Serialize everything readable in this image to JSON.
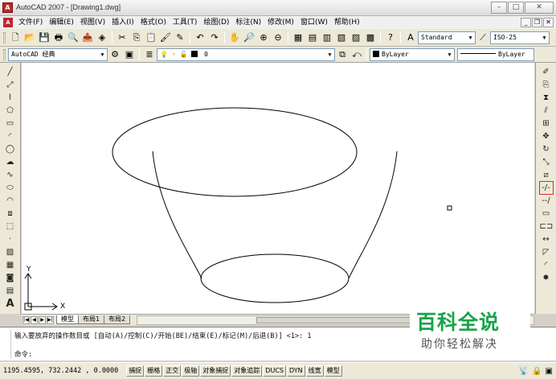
{
  "window": {
    "title": "AutoCAD 2007 - [Drawing1.dwg]",
    "app_icon": "autocad-logo",
    "min": "–",
    "max": "□",
    "close": "✕"
  },
  "menu": {
    "items": [
      "文件(F)",
      "编辑(E)",
      "视图(V)",
      "插入(I)",
      "格式(O)",
      "工具(T)",
      "绘图(D)",
      "标注(N)",
      "修改(M)",
      "窗口(W)",
      "帮助(H)"
    ],
    "doc_min": "_",
    "doc_restore": "❐",
    "doc_close": "✕"
  },
  "toolbar1": {
    "text_style": "Standard",
    "dim_style": "ISO-25"
  },
  "toolbar2": {
    "workspace": "AutoCAD 经典",
    "layer": "0",
    "color": "ByLayer",
    "linetype": "ByLayer"
  },
  "left_tools": [
    "line-icon",
    "construction-line-icon",
    "polyline-icon",
    "polygon-icon",
    "rectangle-icon",
    "arc-icon",
    "circle-icon",
    "revision-cloud-icon",
    "spline-icon",
    "ellipse-icon",
    "ellipse-arc-icon",
    "insert-block-icon",
    "make-block-icon",
    "point-icon",
    "hatch-icon",
    "gradient-icon",
    "region-icon",
    "table-icon",
    "multiline-text-icon"
  ],
  "right_tools": [
    "erase-icon",
    "copy-icon",
    "mirror-icon",
    "offset-icon",
    "array-icon",
    "move-icon",
    "rotate-icon",
    "scale-icon",
    "stretch-icon",
    "trim-icon",
    "extend-icon",
    "break-at-point-icon",
    "break-icon",
    "join-icon",
    "chamfer-icon",
    "fillet-icon",
    "explode-icon"
  ],
  "highlighted_tool": "trim-icon",
  "ucs": {
    "x_label": "X",
    "y_label": "Y"
  },
  "tabs": {
    "model": "模型",
    "layout1": "布局1",
    "layout2": "布局2"
  },
  "command": {
    "history": "输入要放弃的操作数目或 [自动(A)/控制(C)/开始(BE)/结束(E)/标记(M)/后退(B)] <1>: 1",
    "prompt": "命令:"
  },
  "watermark": {
    "title": "百科全说",
    "subtitle": "助你轻松解决"
  },
  "status": {
    "coords": "1195.4595, 732.2442 , 0.0000",
    "buttons": [
      "捕捉",
      "栅格",
      "正交",
      "极轴",
      "对象捕捉",
      "对象追踪",
      "DUCS",
      "DYN",
      "线宽",
      "模型"
    ]
  }
}
